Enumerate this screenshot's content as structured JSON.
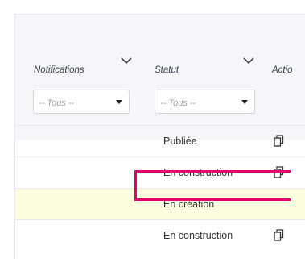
{
  "columns": {
    "notifications": {
      "label": "Notifications",
      "filter_value": "-- Tous --"
    },
    "statut": {
      "label": "Statut",
      "filter_value": "-- Tous --"
    },
    "actions": {
      "label": "Actio"
    }
  },
  "rows": [
    {
      "status": "Publiée",
      "has_copy_icon": true,
      "highlighted": false
    },
    {
      "status": "En construction",
      "has_copy_icon": true,
      "highlighted": false
    },
    {
      "status": "En création",
      "has_copy_icon": false,
      "highlighted": true
    },
    {
      "status": "En construction",
      "has_copy_icon": true,
      "highlighted": false
    }
  ],
  "colors": {
    "highlight_row": "#fffde0",
    "highlight_border": "#e5006e"
  }
}
